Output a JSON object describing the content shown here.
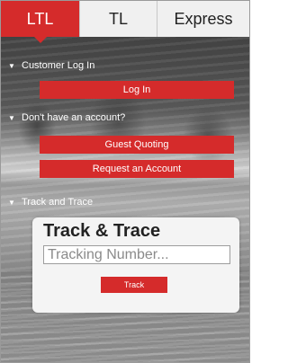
{
  "tabs": [
    {
      "label": "LTL",
      "active": true
    },
    {
      "label": "TL",
      "active": false
    },
    {
      "label": "Express",
      "active": false
    }
  ],
  "sections": {
    "customer_login": {
      "header": "Customer Log In",
      "button": "Log In"
    },
    "no_account": {
      "header": "Don't have an account?",
      "buttons": [
        "Guest Quoting",
        "Request an Account"
      ]
    },
    "track_and_trace": {
      "header": "Track and Trace",
      "card_title": "Track & Trace",
      "input_placeholder": "Tracking Number...",
      "input_value": "",
      "button": "Track"
    }
  },
  "colors": {
    "accent": "#d52b2b",
    "tab_bg": "#f0f0f0",
    "card_bg": "#f4f4f4"
  }
}
